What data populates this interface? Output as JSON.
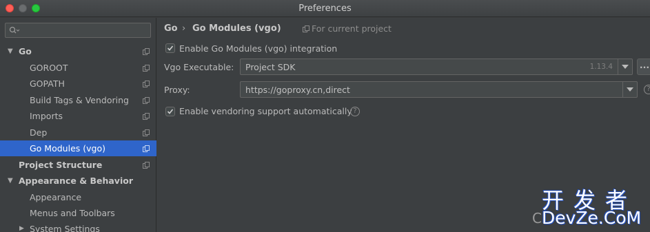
{
  "window": {
    "title": "Preferences"
  },
  "sidebar": {
    "search_placeholder": "",
    "items": [
      {
        "label": "Go",
        "level": 0,
        "expanded": true,
        "icon": "copy-icon"
      },
      {
        "label": "GOROOT",
        "level": 1,
        "icon": "copy-icon"
      },
      {
        "label": "GOPATH",
        "level": 1,
        "icon": "copy-icon"
      },
      {
        "label": "Build Tags & Vendoring",
        "level": 1,
        "icon": "copy-icon"
      },
      {
        "label": "Imports",
        "level": 1,
        "icon": "copy-icon"
      },
      {
        "label": "Dep",
        "level": 1,
        "icon": "copy-icon"
      },
      {
        "label": "Go Modules (vgo)",
        "level": 1,
        "selected": true,
        "icon": "copy-icon"
      },
      {
        "label": "Project Structure",
        "level": 0,
        "icon": "copy-icon"
      },
      {
        "label": "Appearance & Behavior",
        "level": 0,
        "expanded": true
      },
      {
        "label": "Appearance",
        "level": 1
      },
      {
        "label": "Menus and Toolbars",
        "level": 1
      },
      {
        "label": "System Settings",
        "level": 1,
        "collapsed": true
      }
    ]
  },
  "main": {
    "breadcrumb": {
      "parent": "Go",
      "separator": "›",
      "current": "Go Modules (vgo)",
      "scope": "For current project"
    },
    "enable_go_modules": {
      "label": "Enable Go Modules (vgo) integration",
      "checked": true
    },
    "vgo_executable": {
      "label": "Vgo Executable:",
      "value": "Project SDK",
      "version": "1.13.4",
      "more_button": "..."
    },
    "proxy": {
      "label": "Proxy:",
      "value": "https://goproxy.cn,direct"
    },
    "enable_vendoring": {
      "label": "Enable vendoring support automatically",
      "checked": true,
      "help": "?"
    }
  },
  "watermark": {
    "chinese": "开发者",
    "english": "DevZe.CoM",
    "partial": "C"
  },
  "colors": {
    "selection": "#2f65ca",
    "background": "#3c3f41",
    "field": "#45494a"
  }
}
